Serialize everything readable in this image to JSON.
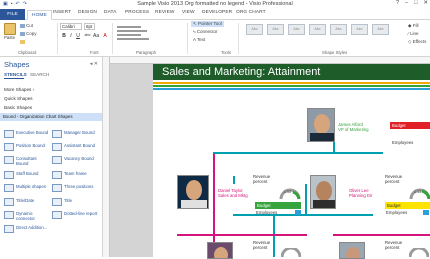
{
  "window": {
    "title": "Sample Visio 2013 Org formatted no legend - Visio Professional",
    "controls": [
      "?",
      "–",
      "□",
      "✕"
    ]
  },
  "tabs": [
    "FILE",
    "HOME",
    "INSERT",
    "DESIGN",
    "DATA",
    "PROCESS",
    "REVIEW",
    "VIEW",
    "DEVELOPER",
    "ORG CHART"
  ],
  "ribbon": {
    "clipboard": {
      "paste": "Paste",
      "cut": "Cut",
      "copy": "Copy",
      "label": "Clipboard"
    },
    "font": {
      "family": "Calibri",
      "size": "8pt",
      "label": "Font",
      "buttons": [
        "B",
        "I",
        "U",
        "abc",
        "Aa",
        "A"
      ]
    },
    "paragraph": {
      "label": "Paragraph"
    },
    "tools": {
      "pointer": "Pointer Tool",
      "connector": "Connector",
      "text": "Text",
      "label": "Tools"
    },
    "shape_styles": {
      "label": "Shape Styles",
      "tiles": [
        "Abc",
        "Abc",
        "Abc",
        "Abc",
        "Abc",
        "Abc",
        "Abc"
      ],
      "fill": "Fill",
      "line": "Line",
      "effects": "Effects"
    }
  },
  "shapes_panel": {
    "title": "Shapes",
    "tabs": [
      "STENCILS",
      "SEARCH"
    ],
    "nav": [
      "More Shapes",
      "Quick Shapes",
      "Basic Shapes"
    ],
    "active_stencil": "Bound - Organization Chart Shapes",
    "items_left": [
      "Executive Bound",
      "Position Bound",
      "Consultant Bound",
      "Staff Bound",
      "Multiple shapes",
      "Title/Date",
      "Dynamic connector",
      "Direct Addition..."
    ],
    "items_right": [
      "Manager Bound",
      "Assistant Bound",
      "Vacancy Bound",
      "Team frame",
      "Three positions",
      "Title",
      "Dotted-line report"
    ]
  },
  "page": {
    "title": "Sales and Marketing:  Attainment",
    "header_color": "#1e5c2a",
    "stripe_colors": [
      "#f2a900",
      "#37a33c",
      "#2b9fd8"
    ],
    "nodes": [
      {
        "name": "James Alford",
        "role": "VP of Marketing",
        "tag": "Budget",
        "employees": "Employees"
      },
      {
        "name": "Daniel Taylor",
        "role": "Sales and Mktg",
        "metric_label": "Revenue percent",
        "gauge": "1.53",
        "tag": "Budget",
        "employees": "Employees"
      },
      {
        "name": "Oliver Lee",
        "role": "Planning Dir",
        "metric_label": "Revenue percent",
        "gauge": "1.33",
        "tag": "Budget",
        "employees": "Employees"
      },
      {
        "metric_label": "Revenue percent"
      },
      {
        "metric_label": "Revenue percent"
      }
    ]
  },
  "colors": {
    "accent": "#2b579a",
    "connector_teal": "#00a0b0",
    "connector_magenta": "#d4147a"
  }
}
